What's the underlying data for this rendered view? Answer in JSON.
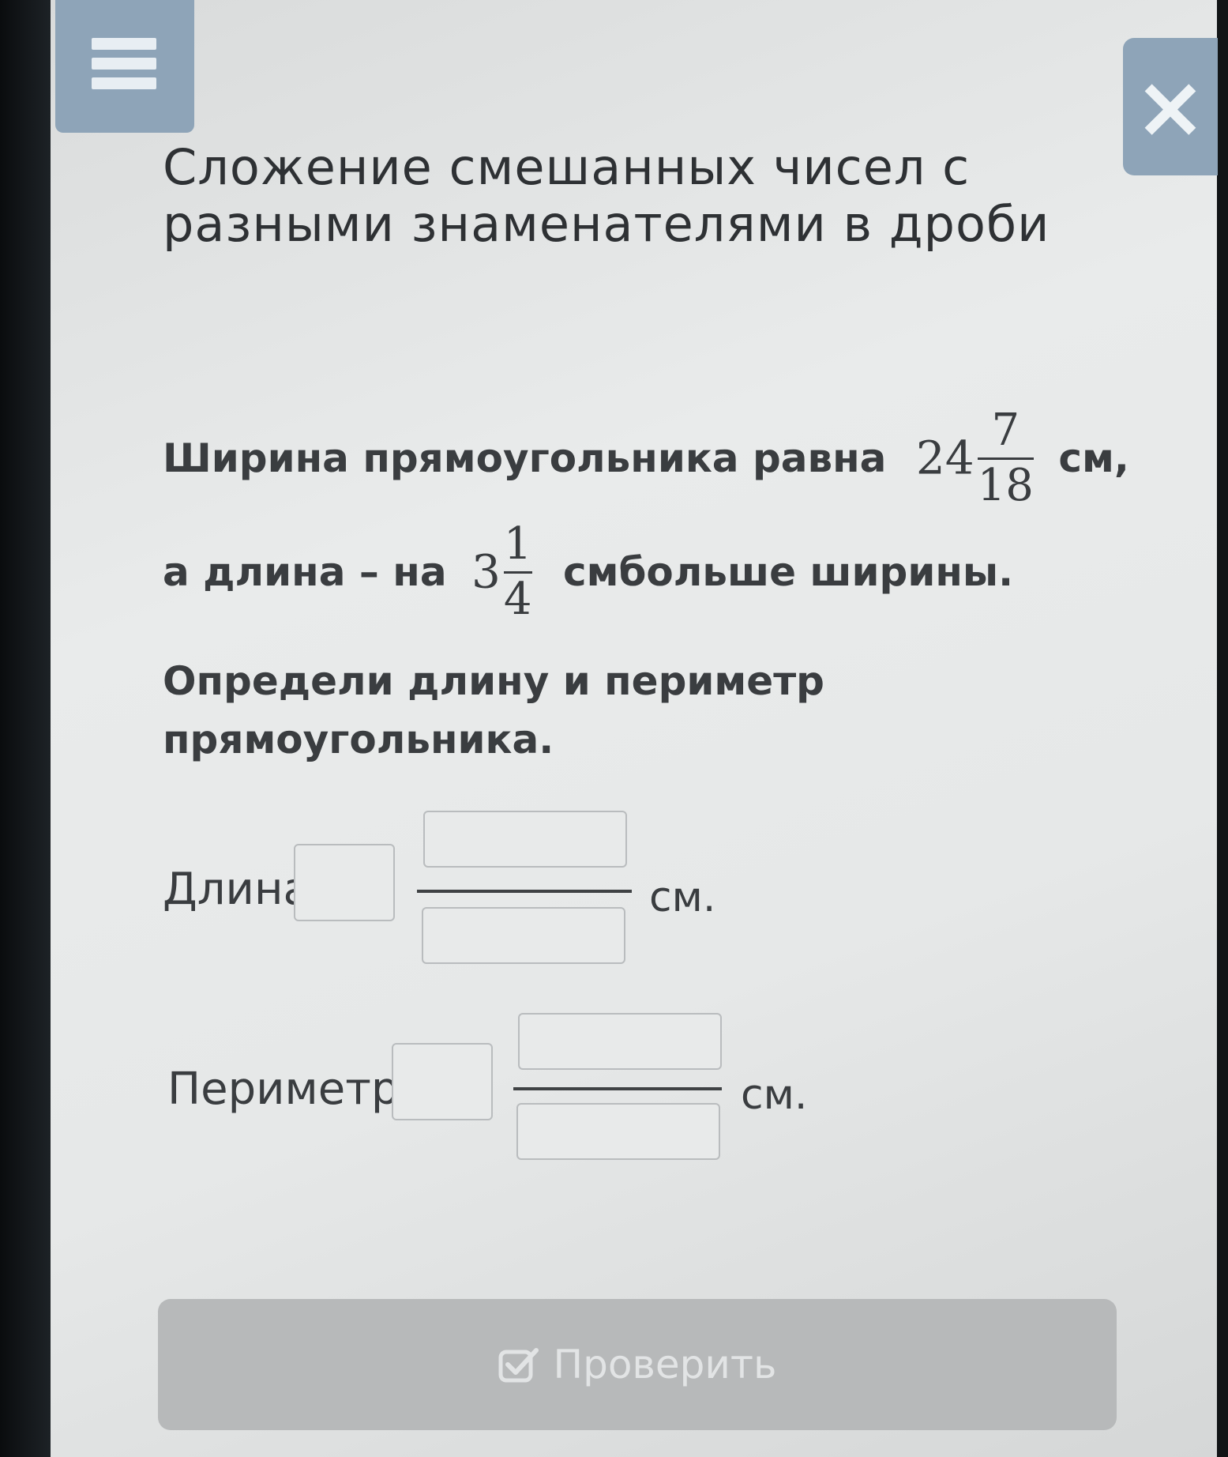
{
  "header": {
    "close_symbol": "×"
  },
  "title": {
    "line1": "Сложение смешанных чисел с",
    "line2": "разными знаменателями в дроби"
  },
  "problem": {
    "line1_text": "Ширина прямоугольника равна",
    "width_whole": "24",
    "width_num": "7",
    "width_den": "18",
    "line1_unit": "см,",
    "line2_prefix": "а длина – на",
    "diff_whole": "3",
    "diff_num": "1",
    "diff_den": "4",
    "line2_suffix": "смбольше ширины.",
    "task_line1": "Определи длину и периметр",
    "task_line2": "прямоугольника."
  },
  "answers": {
    "length_label": "Длина:",
    "length_unit": "см.",
    "perimeter_label": "Периметр:",
    "perimeter_unit": "см."
  },
  "check_button": {
    "label": "Проверить",
    "icon": "checkbox-check-icon"
  }
}
